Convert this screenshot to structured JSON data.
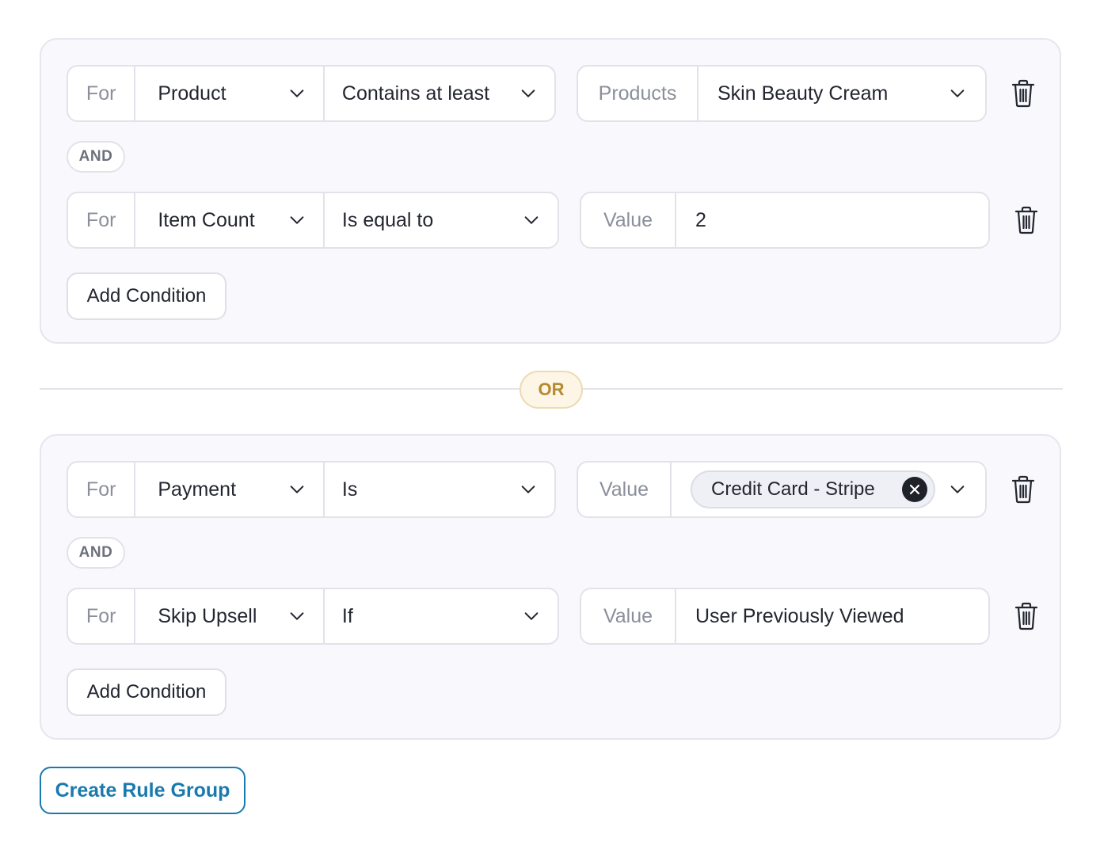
{
  "groups": [
    {
      "conditions": [
        {
          "for_label": "For",
          "field": "Product",
          "operator": "Contains at least",
          "value_label": "Products",
          "value": "Skin Beauty Cream",
          "value_is_select": true
        },
        {
          "for_label": "For",
          "field": "Item Count",
          "operator": "Is equal to",
          "value_label": "Value",
          "value": "2",
          "value_is_select": false
        }
      ],
      "and_label": "AND",
      "add_condition_label": "Add Condition"
    },
    {
      "conditions": [
        {
          "for_label": "For",
          "field": "Payment",
          "operator": "Is",
          "value_label": "Value",
          "value_chip": "Credit Card - Stripe",
          "value_is_select": true
        },
        {
          "for_label": "For",
          "field": "Skip Upsell",
          "operator": "If",
          "value_label": "Value",
          "value": "User Previously Viewed",
          "value_is_select": false
        }
      ],
      "and_label": "AND",
      "add_condition_label": "Add Condition"
    }
  ],
  "or_label": "OR",
  "create_rule_group_label": "Create Rule Group",
  "colors": {
    "accent": "#1a7aae",
    "or_badge_text": "#b58a31",
    "or_badge_bg": "#fdf6e6",
    "group_bg": "#f8f8fd"
  },
  "icons": {
    "delete": "trash-icon",
    "dropdown": "chevron-down-icon",
    "remove_chip": "close-icon"
  }
}
